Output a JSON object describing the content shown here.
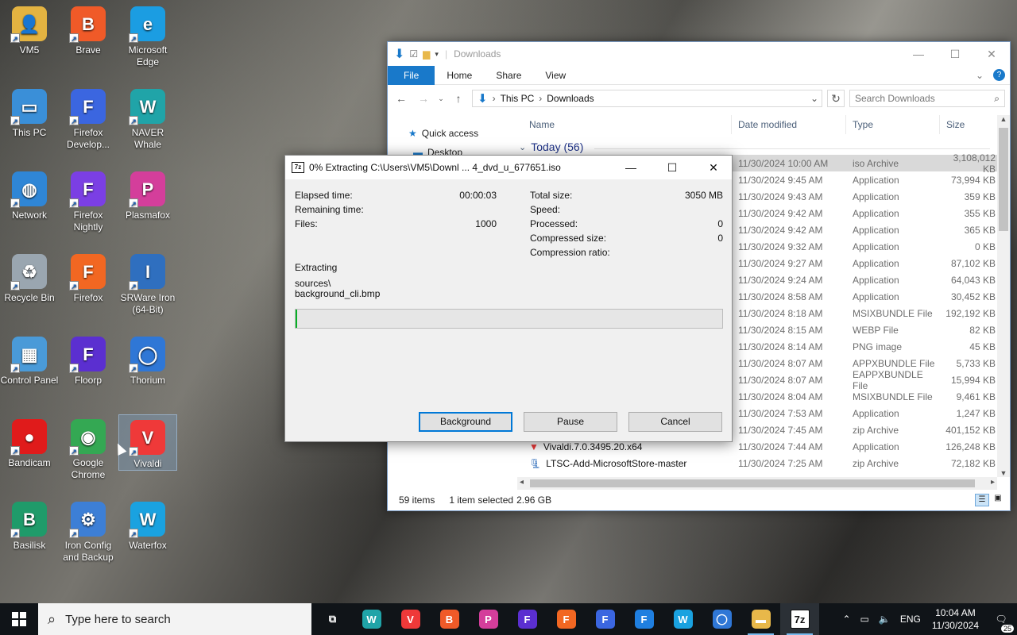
{
  "desktop": {
    "icons": [
      {
        "label": "VM5",
        "color": "#e3b341",
        "glyph": "👤"
      },
      {
        "label": "Brave",
        "color": "#f05a28",
        "glyph": "B"
      },
      {
        "label": "Microsoft Edge",
        "color": "#1b9de2",
        "glyph": "e"
      },
      {
        "label": "This PC",
        "color": "#3a8fd8",
        "glyph": "▭"
      },
      {
        "label": "Firefox Develop...",
        "color": "#3b66e0",
        "glyph": "F"
      },
      {
        "label": "NAVER Whale",
        "color": "#20a4a8",
        "glyph": "W"
      },
      {
        "label": "Network",
        "color": "#2f86d6",
        "glyph": "◍"
      },
      {
        "label": "Firefox Nightly",
        "color": "#7b3fe4",
        "glyph": "F"
      },
      {
        "label": "Plasmafox",
        "color": "#d43e9b",
        "glyph": "P"
      },
      {
        "label": "Recycle Bin",
        "color": "#9aa6b0",
        "glyph": "♻"
      },
      {
        "label": "Firefox",
        "color": "#f26722",
        "glyph": "F"
      },
      {
        "label": "SRWare Iron (64-Bit)",
        "color": "#2f6fbf",
        "glyph": "I"
      },
      {
        "label": "Control Panel",
        "color": "#4a9ad8",
        "glyph": "▦"
      },
      {
        "label": "Floorp",
        "color": "#5b2fd0",
        "glyph": "F"
      },
      {
        "label": "Thorium",
        "color": "#2f77d6",
        "glyph": "◯"
      },
      {
        "label": "Bandicam",
        "color": "#e01b1b",
        "glyph": "●"
      },
      {
        "label": "Google Chrome",
        "color": "#34a853",
        "glyph": "◉"
      },
      {
        "label": "Vivaldi",
        "color": "#ef3939",
        "glyph": "V"
      },
      {
        "label": "Basilisk",
        "color": "#1f9b6a",
        "glyph": "B"
      },
      {
        "label": "Iron Config and Backup",
        "color": "#3d7fd6",
        "glyph": "⚙"
      },
      {
        "label": "Waterfox",
        "color": "#1aa2e0",
        "glyph": "W"
      }
    ]
  },
  "explorer": {
    "title": "Downloads",
    "ribbon_tabs": [
      "File",
      "Home",
      "Share",
      "View"
    ],
    "path": [
      "This PC",
      "Downloads"
    ],
    "search_placeholder": "Search Downloads",
    "nav": {
      "quick_access": "Quick access",
      "desktop": "Desktop"
    },
    "columns": {
      "name": "Name",
      "date": "Date modified",
      "type": "Type",
      "size": "Size"
    },
    "group": "Today (56)",
    "rows": [
      {
        "name": "",
        "date": "11/30/2024 10:00 AM",
        "type": "iso Archive",
        "size": "3,108,012 KB",
        "selected": true
      },
      {
        "name": "",
        "date": "11/30/2024 9:45 AM",
        "type": "Application",
        "size": "73,994 KB"
      },
      {
        "name": "",
        "date": "11/30/2024 9:43 AM",
        "type": "Application",
        "size": "359 KB"
      },
      {
        "name": "",
        "date": "11/30/2024 9:42 AM",
        "type": "Application",
        "size": "355 KB"
      },
      {
        "name": "",
        "date": "11/30/2024 9:42 AM",
        "type": "Application",
        "size": "365 KB"
      },
      {
        "name": "",
        "date": "11/30/2024 9:32 AM",
        "type": "Application",
        "size": "0 KB"
      },
      {
        "name": "",
        "date": "11/30/2024 9:27 AM",
        "type": "Application",
        "size": "87,102 KB"
      },
      {
        "name": "",
        "date": "11/30/2024 9:24 AM",
        "type": "Application",
        "size": "64,043 KB"
      },
      {
        "name": "",
        "date": "11/30/2024 8:58 AM",
        "type": "Application",
        "size": "30,452 KB"
      },
      {
        "name": "",
        "date": "11/30/2024 8:18 AM",
        "type": "MSIXBUNDLE File",
        "size": "192,192 KB"
      },
      {
        "name": "",
        "date": "11/30/2024 8:15 AM",
        "type": "WEBP File",
        "size": "82 KB"
      },
      {
        "name": "",
        "date": "11/30/2024 8:14 AM",
        "type": "PNG image",
        "size": "45 KB"
      },
      {
        "name": "",
        "date": "11/30/2024 8:07 AM",
        "type": "APPXBUNDLE File",
        "size": "5,733 KB"
      },
      {
        "name": "",
        "date": "11/30/2024 8:07 AM",
        "type": "EAPPXBUNDLE File",
        "size": "15,994 KB"
      },
      {
        "name": "",
        "date": "11/30/2024 8:04 AM",
        "type": "MSIXBUNDLE File",
        "size": "9,461 KB"
      },
      {
        "name": "",
        "date": "11/30/2024 7:53 AM",
        "type": "Application",
        "size": "1,247 KB"
      },
      {
        "name": "",
        "date": "11/30/2024 7:45 AM",
        "type": "zip Archive",
        "size": "401,152 KB"
      },
      {
        "name": "Vivaldi.7.0.3495.20.x64",
        "date": "11/30/2024 7:44 AM",
        "type": "Application",
        "size": "126,248 KB"
      },
      {
        "name": "LTSC-Add-MicrosoftStore-master",
        "date": "11/30/2024 7:25 AM",
        "type": "zip Archive",
        "size": "72,182 KB"
      }
    ],
    "status": {
      "count": "59 items",
      "selected": "1 item selected",
      "size": "2.96 GB"
    }
  },
  "dialog": {
    "title": "0% Extracting C:\\Users\\VM5\\Downl ... 4_dvd_u_677651.iso",
    "left": [
      {
        "label": "Elapsed time:",
        "value": "00:00:03"
      },
      {
        "label": "Remaining time:",
        "value": ""
      },
      {
        "label": "Files:",
        "value": "1000"
      }
    ],
    "right": [
      {
        "label": "Total size:",
        "value": "3050 MB"
      },
      {
        "label": "Speed:",
        "value": ""
      },
      {
        "label": "Processed:",
        "value": "0"
      },
      {
        "label": "Compressed size:",
        "value": "0"
      },
      {
        "label": "Compression ratio:",
        "value": ""
      }
    ],
    "status_heading": "Extracting",
    "current_dir": "sources\\",
    "current_file": "background_cli.bmp",
    "progress": 0.004,
    "buttons": {
      "background": "Background",
      "pause": "Pause",
      "cancel": "Cancel"
    },
    "badge": "7z"
  },
  "taskbar": {
    "search_placeholder": "Type here to search",
    "apps": [
      {
        "name": "task-view",
        "glyph": "⧉",
        "color": "#101418"
      },
      {
        "name": "whale",
        "glyph": "W",
        "color": "#20a4a8"
      },
      {
        "name": "vivaldi",
        "glyph": "V",
        "color": "#ef3939"
      },
      {
        "name": "brave",
        "glyph": "B",
        "color": "#f05a28"
      },
      {
        "name": "plasmafox",
        "glyph": "P",
        "color": "#d43e9b"
      },
      {
        "name": "floorp",
        "glyph": "F",
        "color": "#5b2fd0"
      },
      {
        "name": "firefox",
        "glyph": "F",
        "color": "#f26722"
      },
      {
        "name": "firefox-dev",
        "glyph": "F",
        "color": "#3b66e0"
      },
      {
        "name": "firefox-nightly",
        "glyph": "F",
        "color": "#1f7fe0"
      },
      {
        "name": "waterfox",
        "glyph": "W",
        "color": "#1aa2e0"
      },
      {
        "name": "thorium",
        "glyph": "◯",
        "color": "#2f77d6"
      },
      {
        "name": "file-explorer",
        "glyph": "▬",
        "color": "#e8b84a"
      },
      {
        "name": "7zip",
        "glyph": "7z",
        "color": "#2b3036"
      }
    ],
    "language": "ENG",
    "time": "10:04 AM",
    "date": "11/30/2024",
    "notifications": "25"
  }
}
